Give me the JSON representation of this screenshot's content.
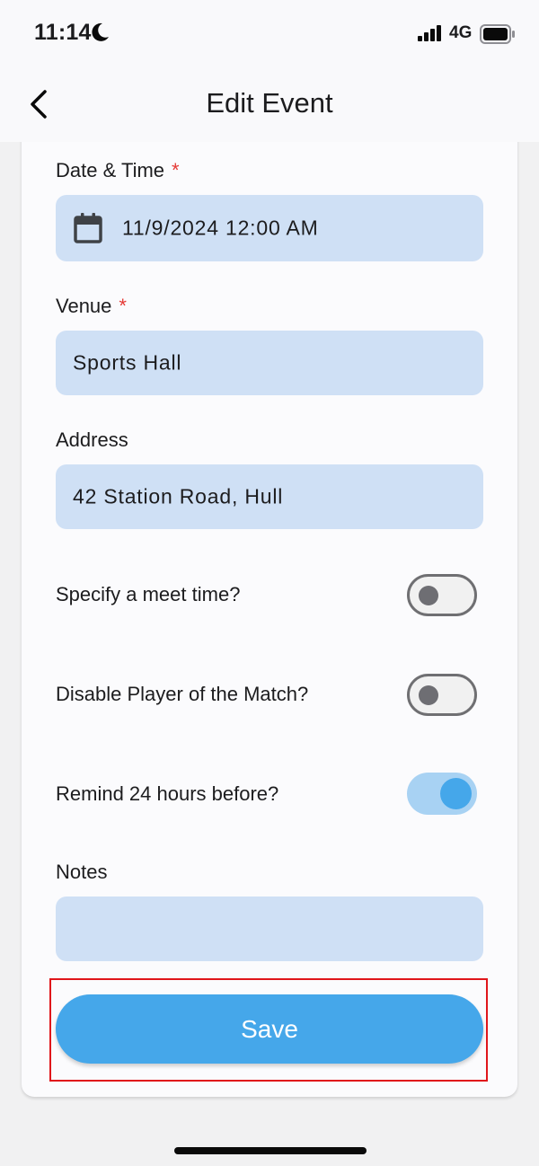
{
  "status_bar": {
    "time": "11:14",
    "network": "4G",
    "icons": [
      "moon-icon",
      "signal-bars-icon",
      "battery-icon"
    ]
  },
  "header": {
    "title": "Edit Event",
    "back_icon": "chevron-left-icon"
  },
  "form": {
    "date_time": {
      "label": "Date & Time",
      "required_mark": "*",
      "value": "11/9/2024 12:00 AM",
      "icon": "calendar-icon"
    },
    "venue": {
      "label": "Venue",
      "required_mark": "*",
      "value": "Sports Hall"
    },
    "address": {
      "label": "Address",
      "value": "42 Station Road, Hull"
    },
    "meet_time": {
      "label": "Specify a meet time?",
      "on": false
    },
    "disable_potm": {
      "label": "Disable Player of the Match?",
      "on": false
    },
    "remind": {
      "label": "Remind 24 hours before?",
      "on": true
    },
    "notes": {
      "label": "Notes",
      "value": ""
    }
  },
  "save_label": "Save",
  "colors": {
    "accent": "#45a7ea",
    "input_fill": "#cfe0f5",
    "required": "#e53935",
    "highlight_box": "#e0161b"
  }
}
